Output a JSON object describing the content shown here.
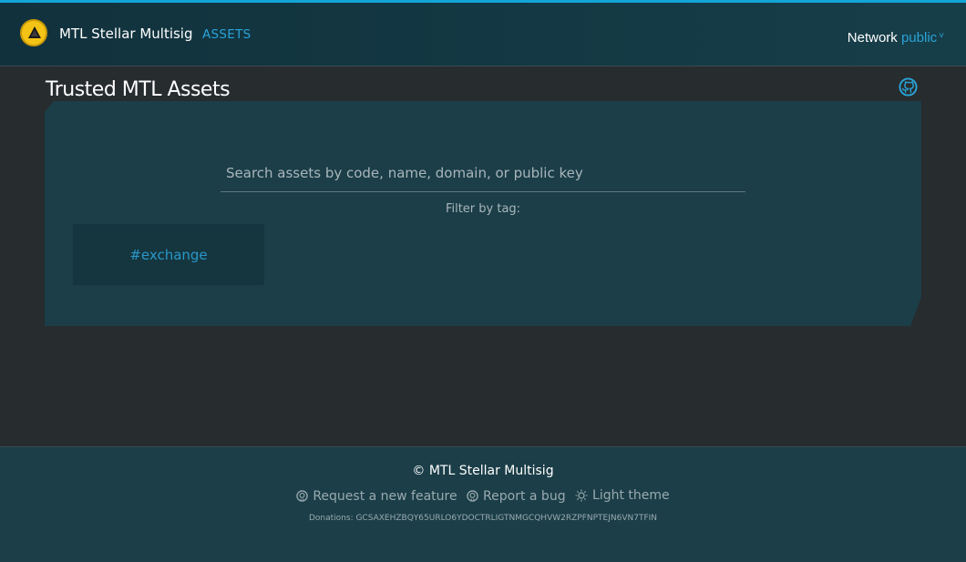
{
  "header": {
    "app_title": "MTL Stellar Multisig",
    "nav_assets": "ASSETS",
    "network_label": "Network",
    "network_value": "public",
    "chevron": "˅"
  },
  "main": {
    "page_title": "Trusted MTL Assets",
    "search": {
      "placeholder": "Search assets by code, name, domain, or public key",
      "value": ""
    },
    "filter_label": "Filter by tag:",
    "tags": [
      "#exchange"
    ]
  },
  "footer": {
    "copyright": "© MTL Stellar Multisig",
    "links": [
      {
        "icon": "github-icon",
        "label": "Request a new feature"
      },
      {
        "icon": "github-icon",
        "label": "Report a bug"
      },
      {
        "icon": "sun-icon",
        "label": "Light theme"
      }
    ],
    "donations": "Donations: GCSAXEHZBQY65URLO6YDOCTRLIGTNMGCQHVW2RZPFNPTEJN6VN7TFIN"
  },
  "colors": {
    "accent": "#12a5d8",
    "link": "#2aa3d8",
    "panel": "#1b3e48",
    "background": "#272c2f",
    "logo": "#f3c316"
  }
}
